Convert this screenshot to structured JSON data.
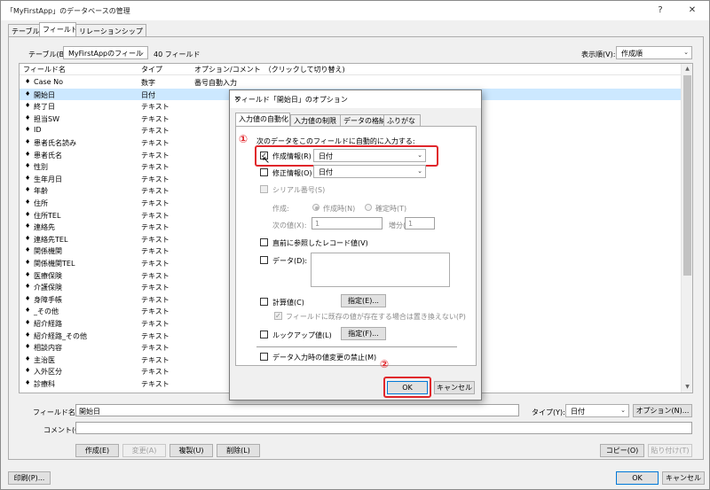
{
  "window": {
    "title": "「MyFirstApp」のデータベースの管理",
    "help": "?",
    "close": "✕"
  },
  "tabs": [
    "テーブル",
    "フィールド",
    "リレーションシップ"
  ],
  "toolbar": {
    "table_label": "テーブル(B):",
    "table_value": "MyFirstAppのフィール",
    "field_count": "40 フィールド",
    "sort_label": "表示順(V):",
    "sort_value": "作成順"
  },
  "list": {
    "headers": [
      "フィールド名",
      "タイプ",
      "オプション/コメント　（クリックして切り替え)"
    ],
    "rows": [
      {
        "name": "Case No",
        "type": "数字",
        "opt": "番号自動入力"
      },
      {
        "name": "開始日",
        "type": "日付",
        "opt": ""
      },
      {
        "name": "終了日",
        "type": "テキスト",
        "opt": ""
      },
      {
        "name": "担当SW",
        "type": "テキスト",
        "opt": ""
      },
      {
        "name": "ID",
        "type": "テキスト",
        "opt": ""
      },
      {
        "name": "患者氏名読み",
        "type": "テキスト",
        "opt": ""
      },
      {
        "name": "患者氏名",
        "type": "テキスト",
        "opt": ""
      },
      {
        "name": "性別",
        "type": "テキスト",
        "opt": ""
      },
      {
        "name": "生年月日",
        "type": "テキスト",
        "opt": ""
      },
      {
        "name": "年齢",
        "type": "テキスト",
        "opt": ""
      },
      {
        "name": "住所",
        "type": "テキスト",
        "opt": ""
      },
      {
        "name": "住所TEL",
        "type": "テキスト",
        "opt": ""
      },
      {
        "name": "連絡先",
        "type": "テキスト",
        "opt": ""
      },
      {
        "name": "連絡先TEL",
        "type": "テキスト",
        "opt": ""
      },
      {
        "name": "関係機関",
        "type": "テキスト",
        "opt": ""
      },
      {
        "name": "関係機関TEL",
        "type": "テキスト",
        "opt": ""
      },
      {
        "name": "医療保険",
        "type": "テキスト",
        "opt": ""
      },
      {
        "name": "介護保険",
        "type": "テキスト",
        "opt": ""
      },
      {
        "name": "身障手帳",
        "type": "テキスト",
        "opt": ""
      },
      {
        "name": "_その他",
        "type": "テキスト",
        "opt": ""
      },
      {
        "name": "紹介経路",
        "type": "テキスト",
        "opt": ""
      },
      {
        "name": "紹介経路_その他",
        "type": "テキスト",
        "opt": ""
      },
      {
        "name": "相談内容",
        "type": "テキスト",
        "opt": ""
      },
      {
        "name": "主治医",
        "type": "テキスト",
        "opt": ""
      },
      {
        "name": "入外区分",
        "type": "テキスト",
        "opt": ""
      },
      {
        "name": "診療科",
        "type": "テキスト",
        "opt": ""
      }
    ],
    "selected_index": 1
  },
  "bottom": {
    "field_name_label": "フィールド名(F):",
    "field_name_value": "開始日",
    "type_label": "タイプ(Y):",
    "type_value": "日付",
    "options_button": "オプション(N)...",
    "comment_label": "コメント(C):",
    "comment_value": "",
    "create": "作成(E)",
    "change": "変更(A)",
    "duplicate": "複製(U)",
    "delete": "削除(L)",
    "copy": "コピー(O)",
    "paste": "貼り付け(T)",
    "print": "印刷(P)...",
    "ok": "OK",
    "cancel": "キャンセル"
  },
  "dialog": {
    "title": "フィールド「開始日」のオプション",
    "close": "✕",
    "tabs": [
      "入力値の自動化",
      "入力値の制限",
      "データの格納",
      "ふりがな"
    ],
    "heading": "次のデータをこのフィールドに自動的に入力する:",
    "annot1": "①",
    "annot2": "②",
    "creation_info": "作成情報(R)",
    "creation_value": "日付",
    "modification_info": "修正情報(O)",
    "modification_value": "日付",
    "serial": "シリアル番号(S)",
    "generate_label": "作成:",
    "on_creation": "作成時(N)",
    "on_commit": "確定時(T)",
    "next_value_label": "次の値(X):",
    "next_value": "1",
    "increment_label": "増分(I):",
    "increment_value": "1",
    "last_visited": "直前に参照したレコード値(V)",
    "data": "データ(D):",
    "calculated": "計算値(C)",
    "specify_calc": "指定(E)...",
    "no_replace": "フィールドに既存の値が存在する場合は置き換えない(P)",
    "lookup": "ルックアップ値(L)",
    "specify_lookup": "指定(F)...",
    "prohibit": "データ入力時の値変更の禁止(M)",
    "ok": "OK",
    "cancel": "キャンセル"
  },
  "colors": {
    "selection": "#cce8ff",
    "annotation_red": "#e0262b"
  }
}
